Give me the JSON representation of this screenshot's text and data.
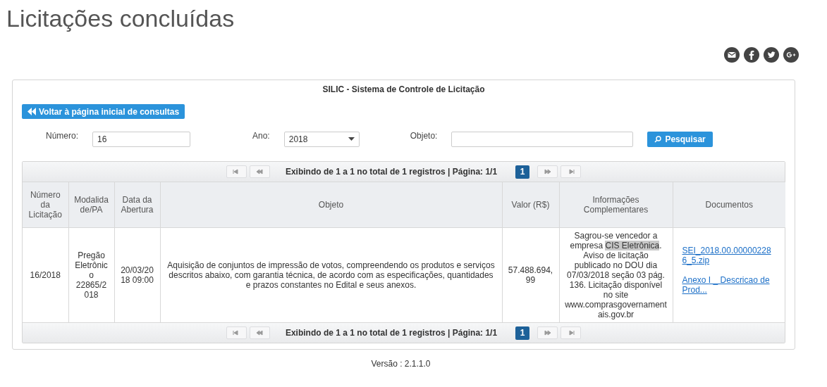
{
  "page_title": "Licitações concluídas",
  "share_icons": [
    {
      "kind": "email"
    },
    {
      "kind": "facebook"
    },
    {
      "kind": "twitter"
    },
    {
      "kind": "googleplus"
    }
  ],
  "panel": {
    "title": "SILIC - Sistema de Controle de Licitação",
    "back_button": "Voltar à página inicial de consultas",
    "filters": [
      {
        "kind": "text",
        "label": "Número:",
        "value": "16"
      },
      {
        "kind": "select",
        "label": "Ano:",
        "value": "2018"
      },
      {
        "kind": "text",
        "label": "Objeto:"
      }
    ],
    "search_button": "Pesquisar",
    "pagers": [
      {
        "summary": "Exibindo de **1** a **1** no total de **1** registros | Página: 1/1",
        "pages": [
          {
            "label": "1",
            "selected": true
          }
        ]
      },
      {
        "summary": "Exibindo de **1** a **1** no total de **1** registros | Página: 1/1",
        "pages": [
          {
            "label": "1",
            "selected": true
          }
        ]
      }
    ],
    "table": {
      "columns": [
        "Número da Licitação",
        "Modalidade/PA",
        "Data da Abertura",
        "Objeto",
        "Valor (R$)",
        "Informações Complementares",
        "Documentos"
      ],
      "rows": [
        {
          "numero": "16/2018",
          "modalidade": "Pregão Eletrônico 22865/2018",
          "data": "20/03/2018 09:00",
          "objeto": "Aquisição de conjuntos de impressão de votos, compreendendo os produtos e serviços descritos abaixo, com garantia técnica, de acordo com as especificações, quantidades e prazos constantes no Edital e seus anexos.",
          "valor": "57.488.694,99",
          "info": [
            {
              "text": "Sagrou-se vencedor a empresa ",
              "highlighted": false
            },
            {
              "text": "CIS Eletrônica",
              "highlighted": true
            },
            {
              "text": ". Aviso de licitação publicado no DOU dia 07/03/2018 seção 03 pág. 136. Licitação disponível no site www.comprasgovernamentais.gov.br",
              "highlighted": false
            }
          ],
          "documents": [
            "SEI_2018.00.000002286_5.zip",
            "Anexo I _ Descricao de Prod..."
          ]
        }
      ]
    }
  },
  "version": "Versão : 2.1.1.0"
}
